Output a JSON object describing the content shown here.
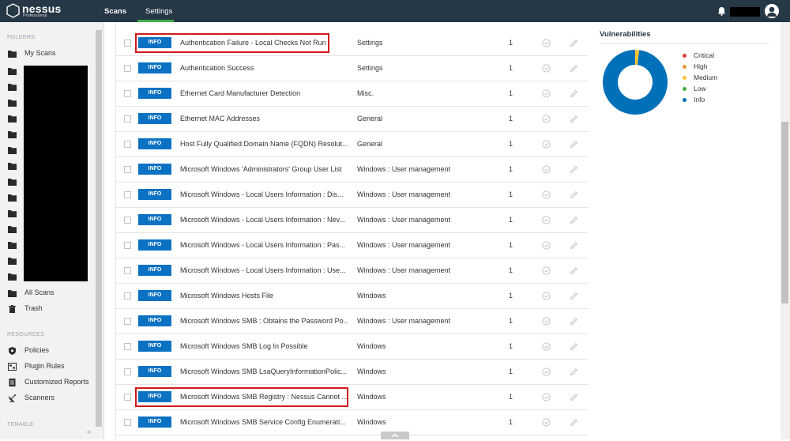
{
  "app": {
    "brand_name": "nessus",
    "brand_sub": "Professional"
  },
  "topnav": {
    "tabs": [
      {
        "label": "Scans",
        "active": false
      },
      {
        "label": "Settings",
        "active": true
      }
    ]
  },
  "sidebar": {
    "folders_header": "FOLDERS",
    "my_scans": "My Scans",
    "all_scans": "All Scans",
    "trash": "Trash",
    "resources_header": "RESOURCES",
    "resources": [
      "Policies",
      "Plugin Rules",
      "Customized Reports",
      "Scanners"
    ],
    "tenable_header": "TENABLE",
    "collapse_glyph": "«"
  },
  "table": {
    "rows": [
      {
        "severity": "INFO",
        "name": "Authentication Failure - Local Checks Not Run",
        "family": "Settings",
        "count": "1",
        "highlighted": true
      },
      {
        "severity": "INFO",
        "name": "Authentication Success",
        "family": "Settings",
        "count": "1"
      },
      {
        "severity": "INFO",
        "name": "Ethernet Card Manufacturer Detection",
        "family": "Misc.",
        "count": "1"
      },
      {
        "severity": "INFO",
        "name": "Ethernet MAC Addresses",
        "family": "General",
        "count": "1"
      },
      {
        "severity": "INFO",
        "name": "Host Fully Qualified Domain Name (FQDN) Resolut...",
        "family": "General",
        "count": "1"
      },
      {
        "severity": "INFO",
        "name": "Microsoft Windows 'Administrators' Group User List",
        "family": "Windows : User management",
        "count": "1"
      },
      {
        "severity": "INFO",
        "name": "Microsoft Windows - Local Users Information : Dis...",
        "family": "Windows : User management",
        "count": "1"
      },
      {
        "severity": "INFO",
        "name": "Microsoft Windows - Local Users Information : Nev...",
        "family": "Windows : User management",
        "count": "1"
      },
      {
        "severity": "INFO",
        "name": "Microsoft Windows - Local Users Information : Pas...",
        "family": "Windows : User management",
        "count": "1"
      },
      {
        "severity": "INFO",
        "name": "Microsoft Windows - Local Users Information : Use...",
        "family": "Windows : User management",
        "count": "1"
      },
      {
        "severity": "INFO",
        "name": "Microsoft Windows Hosts File",
        "family": "Windows",
        "count": "1"
      },
      {
        "severity": "INFO",
        "name": "Microsoft Windows SMB : Obtains the Password Po...",
        "family": "Windows : User management",
        "count": "1"
      },
      {
        "severity": "INFO",
        "name": "Microsoft Windows SMB Log In Possible",
        "family": "Windows",
        "count": "1"
      },
      {
        "severity": "INFO",
        "name": "Microsoft Windows SMB LsaQueryInformationPolic...",
        "family": "Windows",
        "count": "1"
      },
      {
        "severity": "INFO",
        "name": "Microsoft Windows SMB Registry : Nessus Cannot ...",
        "family": "Windows",
        "count": "1",
        "highlighted": true
      },
      {
        "severity": "INFO",
        "name": "Microsoft Windows SMB Service Config Enumerati...",
        "family": "Windows",
        "count": "1"
      }
    ]
  },
  "vulnerabilities": {
    "title": "Vulnerabilities",
    "legend": [
      {
        "label": "Critical",
        "color": "#d43f3a"
      },
      {
        "label": "High",
        "color": "#ee9336"
      },
      {
        "label": "Medium",
        "color": "#fdc431"
      },
      {
        "label": "Low",
        "color": "#3fae49"
      },
      {
        "label": "Info",
        "color": "#0071b9"
      }
    ]
  },
  "chart_data": {
    "type": "pie",
    "categories": [
      "Critical",
      "High",
      "Medium",
      "Low",
      "Info"
    ],
    "values": [
      0,
      0,
      2,
      0,
      98
    ],
    "colors": [
      "#d43f3a",
      "#ee9336",
      "#fdc431",
      "#3fae49",
      "#0071b9"
    ]
  }
}
